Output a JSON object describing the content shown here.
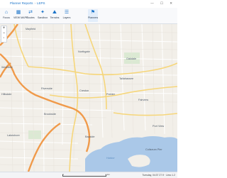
{
  "breadcrumb": {
    "items": [
      "Planner Reports",
      "LEPS"
    ]
  },
  "toolbar": {
    "items": [
      {
        "label": "Focus",
        "icon": "⌂"
      },
      {
        "label": "VIEW MAPS",
        "icon": "▦"
      },
      {
        "label": "Routes",
        "icon": "⇄"
      },
      {
        "label": "Sandbox",
        "icon": "✦"
      },
      {
        "label": "Terrains",
        "icon": "⛰"
      },
      {
        "label": "Layers",
        "icon": "☰"
      },
      {
        "label": "Planners",
        "icon": "⚑"
      }
    ]
  },
  "map": {
    "labels": {
      "mayfield": "Mayfield",
      "westfield": "Westfield",
      "tallahassee": "Tallahassee",
      "pointer": "Pointer",
      "creston": "Creston",
      "riverside": "Riverside",
      "hillsdale": "Hillsdale",
      "brookside": "Brookside",
      "northgate": "Northgate",
      "oakdale": "Oakdale",
      "fairview": "Fairview",
      "lakeshore": "Lakeshore",
      "bayside": "Bayside",
      "harbor": "Harbor",
      "port_view": "Port View",
      "coliseum_pier": "Coliseum Pier"
    }
  },
  "zoom": {
    "in": "+",
    "out": "−",
    "reset": "◦"
  },
  "status": {
    "scale_left": "0",
    "scale_right": "1 km",
    "text": "Tuesday, 04:37 27.9 · Limo 1.2"
  },
  "window": {
    "controls": "— ☐ ✕"
  }
}
